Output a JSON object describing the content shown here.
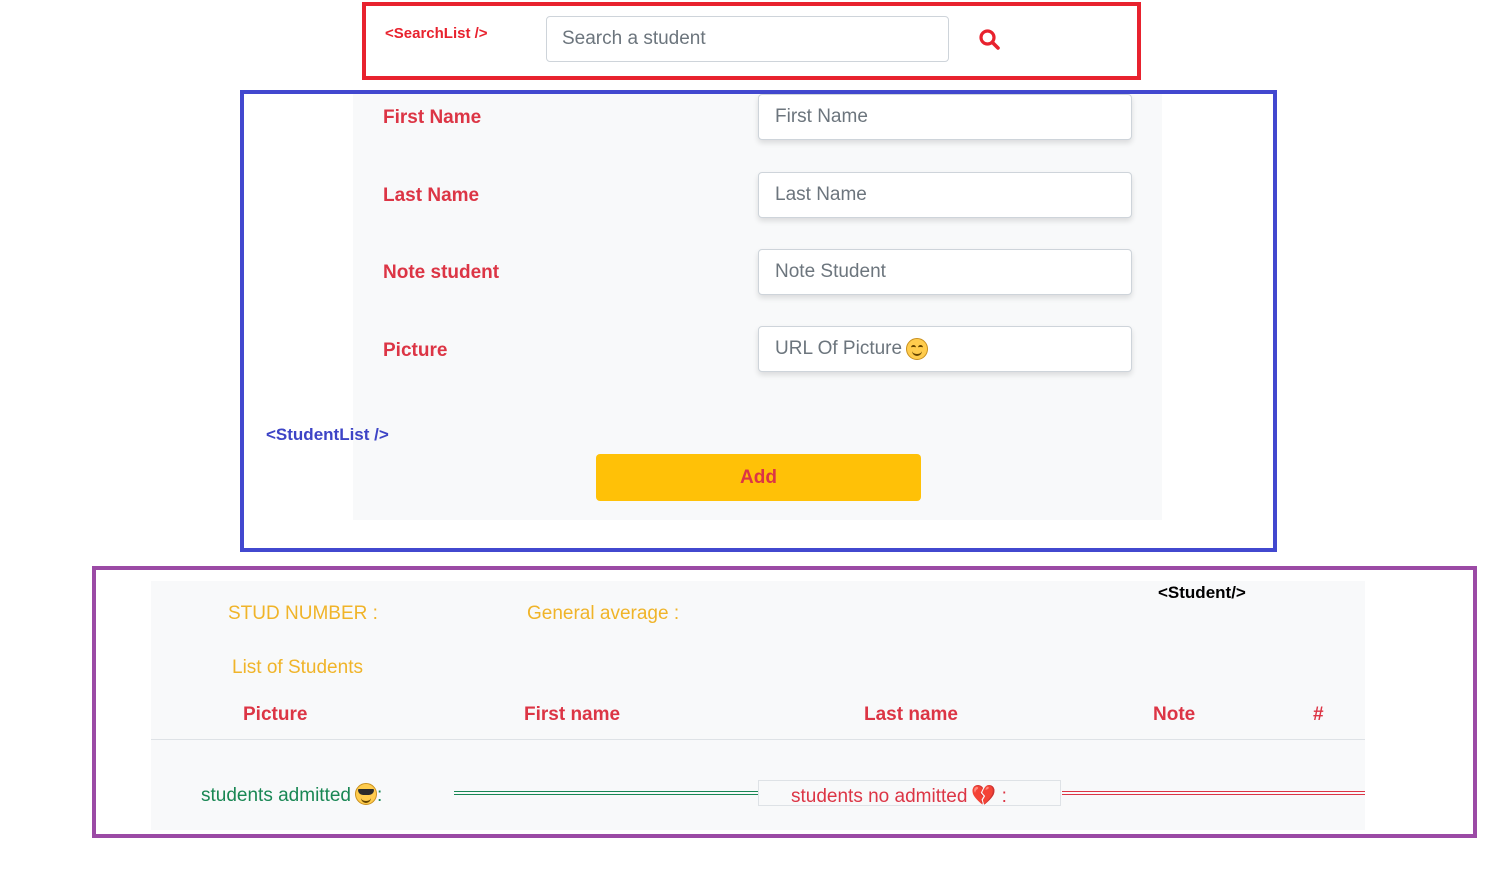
{
  "search_list": {
    "tag": "<SearchList />",
    "input_placeholder": "Search a student"
  },
  "student_list": {
    "tag": "<StudentList />",
    "fields": {
      "first_name": {
        "label": "First Name",
        "placeholder": "First Name"
      },
      "last_name": {
        "label": "Last Name",
        "placeholder": "Last Name"
      },
      "note": {
        "label": "Note student",
        "placeholder": "Note Student"
      },
      "picture": {
        "label": "Picture",
        "placeholder": "URL Of Picture"
      }
    },
    "add_button": "Add"
  },
  "student": {
    "tag": "<Student/>",
    "stud_number_label": "STUD NUMBER :",
    "general_average_label": "General average :",
    "list_title": "List of Students",
    "columns": [
      "Picture",
      "First name",
      "Last name",
      "Note",
      "#"
    ],
    "admitted_label": "students admitted",
    "admitted_suffix": ":",
    "not_admitted_label": "students no admitted",
    "not_admitted_suffix": ":"
  },
  "icons": {
    "search": "magnifier-icon",
    "picture_emoji": "smiling-face-icon",
    "admitted_emoji": "sunglasses-face-icon",
    "not_admitted_emoji": "broken-heart-icon"
  },
  "colors": {
    "search_frame": "#e8222e",
    "studentlist_frame": "#4248cf",
    "student_frame": "#9b4aa5",
    "label_red": "#dc3545",
    "button_yellow": "#ffc107",
    "heading_yellow": "#f0b429",
    "admitted_green": "#198754"
  }
}
